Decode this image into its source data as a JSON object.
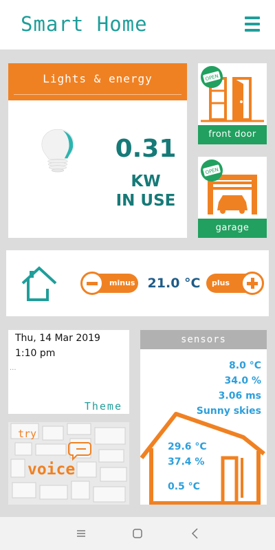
{
  "app": {
    "title": "Smart Home",
    "accent": "#1f9e9a",
    "orange": "#f08122",
    "green": "#21a05f"
  },
  "header": {
    "menu_icon": "hamburger-menu-icon"
  },
  "lights": {
    "title": "Lights & energy",
    "kw_value": "0.31",
    "kw_unit_line1": "KW",
    "kw_unit_line2": "IN USE",
    "icon": "lightbulb-icon"
  },
  "front_door": {
    "label": "front door",
    "sign": "OPEN",
    "icon": "door-icon"
  },
  "garage": {
    "label": "garage",
    "sign": "OPEN",
    "icon": "garage-icon"
  },
  "thermostat": {
    "minus_label": "minus",
    "plus_label": "plus",
    "target_temp": "21.0 °C",
    "icon": "home-icon"
  },
  "datetime": {
    "date": "Thu, 14 Mar 2019",
    "time": "1:10 pm",
    "ellipsis": "...",
    "theme_label": "Theme"
  },
  "voice": {
    "try_label": "try",
    "voice_label": "voice"
  },
  "sensors": {
    "title": "sensors",
    "outside": [
      "8.0 °C",
      "34.0 %",
      "3.06 ms",
      "Sunny skies"
    ],
    "inside": [
      "29.6 °C",
      "37.4 %",
      "0.5 °C"
    ]
  },
  "navbar": {
    "icons": [
      "recent-apps-icon",
      "home-button-icon",
      "back-icon"
    ]
  }
}
